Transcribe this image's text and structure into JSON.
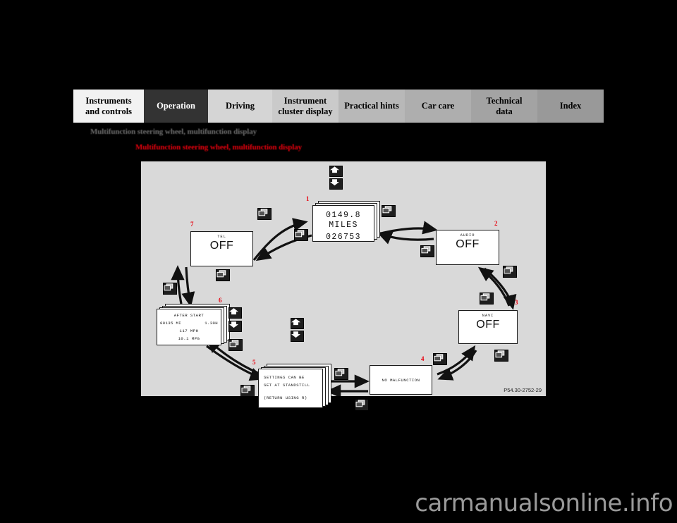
{
  "tabs": [
    {
      "label": "Instruments\nand controls",
      "bg": "#f2f2f2",
      "active": false
    },
    {
      "label": "Operation",
      "bg": "#333333",
      "active": true
    },
    {
      "label": "Driving",
      "bg": "#d5d5d5",
      "active": false
    },
    {
      "label": "Instrument\ncluster display",
      "bg": "#cacaca",
      "active": false
    },
    {
      "label": "Practical hints",
      "bg": "#b8b8b8",
      "active": false
    },
    {
      "label": "Car care",
      "bg": "#aeaeae",
      "active": false
    },
    {
      "label": "Technical\ndata",
      "bg": "#a3a3a3",
      "active": false
    },
    {
      "label": "Index",
      "bg": "#999999",
      "active": false
    }
  ],
  "headings": {
    "gray": "Multifunction steering wheel, multifunction display",
    "red": "Multifunction steering wheel, multifunction display"
  },
  "colors": {
    "callout_red": "#e8000d",
    "heading_gray": "#6e6e6e",
    "diagram_bg": "#d9d9d9",
    "button_dark": "#1e1e1e"
  },
  "diagram": {
    "part_number": "P54.30-2752-29",
    "callouts": [
      "1",
      "2",
      "3",
      "4",
      "5",
      "6",
      "7"
    ],
    "screens": {
      "odometer": {
        "callout": "1",
        "line1": "0149.8",
        "line2": "MILES",
        "line3": "026753"
      },
      "audio": {
        "callout": "2",
        "title": "AUDIO",
        "value": "OFF"
      },
      "navi": {
        "callout": "3",
        "title": "NAVI",
        "value": "OFF"
      },
      "malfunction": {
        "callout": "4",
        "text": "NO MALFUNCTION"
      },
      "settings": {
        "callout": "5",
        "line1": "SETTINGS CAN BE",
        "line2": "SET AT STANDSTILL",
        "line3": "(RETURN USING R)"
      },
      "after_start": {
        "callout": "6",
        "title": "AFTER START",
        "distance": "00135 MI",
        "hours": "1.30H",
        "speed": "117 MPH",
        "economy": "10.1 MPG"
      },
      "tel": {
        "callout": "7",
        "title": "TEL",
        "value": "OFF"
      }
    },
    "icons": {
      "up": "arrow-up-button-icon",
      "down": "arrow-down-button-icon",
      "page": "page-switch-button-icon"
    }
  },
  "watermark": "carmanualsonline.info"
}
